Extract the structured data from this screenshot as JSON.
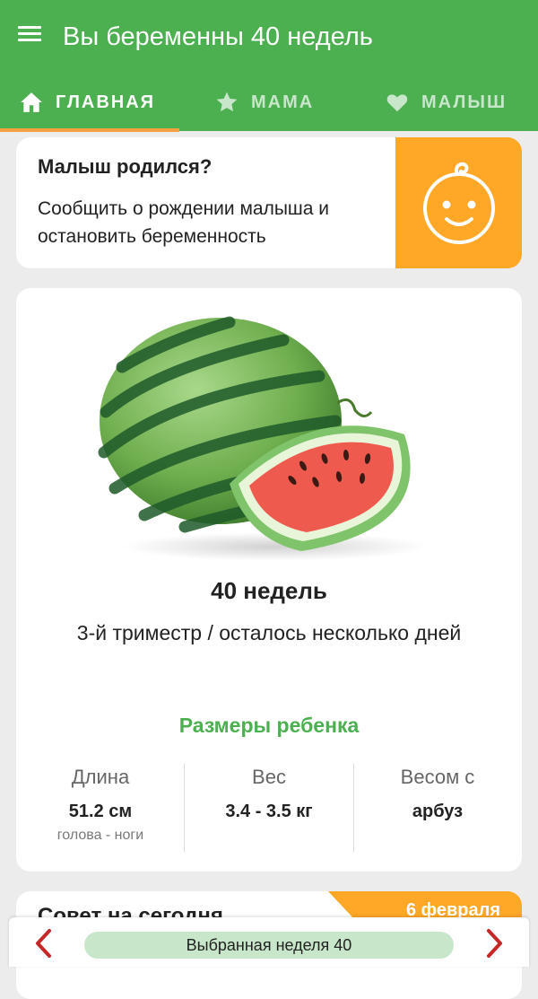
{
  "app_bar": {
    "title": "Вы беременны 40 недель"
  },
  "tabs": [
    {
      "label": "ГЛАВНАЯ",
      "icon": "home-icon",
      "active": true
    },
    {
      "label": "МАМА",
      "icon": "star-icon",
      "active": false
    },
    {
      "label": "МАЛЫШ",
      "icon": "heart-icon",
      "active": false
    }
  ],
  "born_card": {
    "title": "Малыш родился?",
    "text": "Сообщить о рождении малыша и остановить беременность",
    "icon": "baby-face-icon"
  },
  "week_card": {
    "image": "watermelon",
    "title": "40 недель",
    "subtitle": "3-й триместр / осталось несколько дней",
    "sizes_title": "Размеры ребенка",
    "stats": [
      {
        "label": "Длина",
        "value": "51.2 см",
        "note": "голова - ноги"
      },
      {
        "label": "Вес",
        "value": "3.4 - 3.5 кг",
        "note": ""
      },
      {
        "label": "Весом с",
        "value": "арбуз",
        "note": ""
      }
    ]
  },
  "advice_card": {
    "title": "Совет на сегодня",
    "date": "6 февраля"
  },
  "bottom_bar": {
    "selected_week": "Выбранная неделя 40"
  },
  "colors": {
    "primary": "#4caf50",
    "accent": "#ffa726",
    "tab_indicator": "#ff9f43",
    "pill": "#c8e6c9",
    "arrow": "#c62828"
  }
}
